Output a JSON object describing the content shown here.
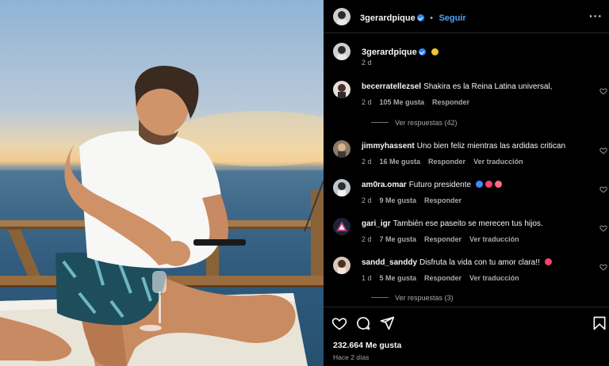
{
  "post": {
    "username": "3gerardpique",
    "follow_label": "Seguir",
    "caption_time": "2 d",
    "likes": "232.664 Me gusta",
    "time_ago": "Hace 2 días"
  },
  "comments": [
    {
      "user": "becerratellezsel",
      "text": "Shakira es la Reina Latina universal,",
      "time": "2 d",
      "likes": "105 Me gusta",
      "reply": "Responder",
      "translate": "",
      "view_replies": "Ver respuestas (42)"
    },
    {
      "user": "jimmyhassent",
      "text": "Uno bien feliz mientras las ardidas critican",
      "time": "2 d",
      "likes": "16 Me gusta",
      "reply": "Responder",
      "translate": "Ver traducción",
      "view_replies": ""
    },
    {
      "user": "am0ra.omar",
      "text": "Futuro presidente",
      "time": "2 d",
      "likes": "9 Me gusta",
      "reply": "Responder",
      "translate": "",
      "view_replies": ""
    },
    {
      "user": "gari_igr",
      "text": "También ese paseito se merecen tus hijos.",
      "time": "2 d",
      "likes": "7 Me gusta",
      "reply": "Responder",
      "translate": "Ver traducción",
      "view_replies": ""
    },
    {
      "user": "sandd_sanddy",
      "text": "Disfruta la vida con tu amor clara!!",
      "time": "1 d",
      "likes": "5 Me gusta",
      "reply": "Responder",
      "translate": "Ver traducción",
      "view_replies": "Ver respuestas (3)"
    }
  ],
  "colors": {
    "link": "#4aa3ff",
    "verified": "#2f89f5",
    "muted": "#a8a8a8",
    "heart_emoji": "#ff3f6c",
    "blue_heart": "#3d8bff"
  },
  "icons": [
    "more-options-icon",
    "heart-icon",
    "comment-icon",
    "share-icon",
    "bookmark-icon",
    "verified-icon"
  ]
}
